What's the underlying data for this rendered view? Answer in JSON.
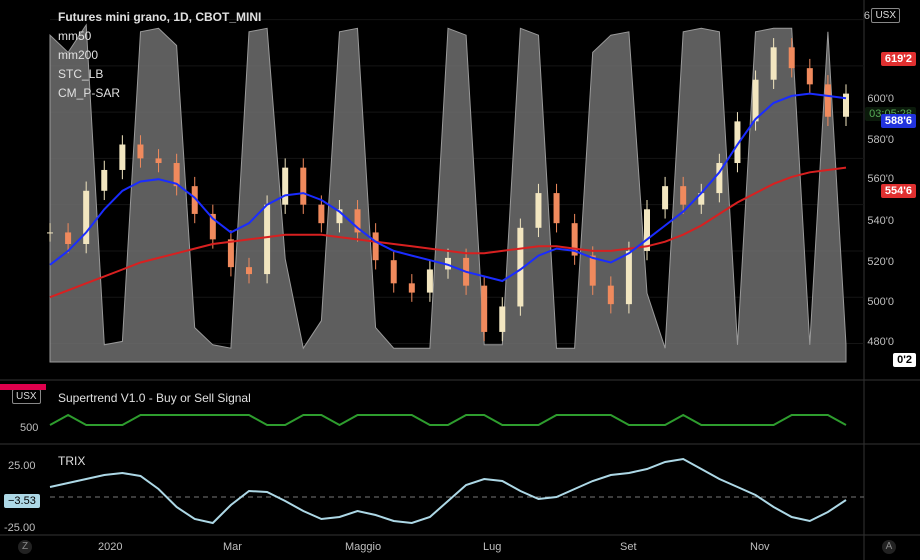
{
  "legend": {
    "title": "Futures mini grano, 1D, CBOT_MINI",
    "items": [
      "mm50",
      "mm200",
      "STC_LB",
      "CM_P-SAR"
    ]
  },
  "currency": "USX",
  "currency2": "USX",
  "price_axis": {
    "ticks": [
      "6",
      "600'0",
      "580'0",
      "560'0",
      "540'0",
      "520'0",
      "500'0",
      "480'0"
    ],
    "tags": {
      "psar": "619'2",
      "last": "588'6",
      "countdown": "03:05:28",
      "mm50": "554'6",
      "stc": "0'2"
    },
    "colors": {
      "psar": "#e03030",
      "last": "#2233dd",
      "mm50": "#e03030",
      "stc": "#ffffff"
    }
  },
  "supertrend": {
    "title": "Supertrend V1.0 - Buy or Sell Signal",
    "tick": "500",
    "tag_color": "#e0004d"
  },
  "trix": {
    "title": "TRIX",
    "ticks": [
      "25.00",
      "-25.00"
    ],
    "tag": "−3.53"
  },
  "x_axis": {
    "labels": [
      "2020",
      "Mar",
      "Maggio",
      "Lug",
      "Set",
      "Nov"
    ]
  },
  "corner_left": "Z",
  "corner_right": "A",
  "chart_data": {
    "type": "line",
    "x_labels": [
      "2020",
      "Mar",
      "Maggio",
      "Lug",
      "Set",
      "Nov"
    ],
    "ylim": [
      472,
      625
    ],
    "series": [
      {
        "name": "mm50",
        "color": "#1a2cff",
        "values": [
          514,
          520,
          528,
          538,
          546,
          550,
          551,
          549,
          543,
          534,
          528,
          532,
          540,
          544,
          545,
          542,
          537,
          530,
          524,
          520,
          518,
          516,
          514,
          511,
          509,
          507,
          512,
          518,
          521,
          520,
          517,
          515,
          519,
          525,
          531,
          537,
          545,
          554,
          566,
          577,
          584,
          587,
          588,
          587,
          586
        ]
      },
      {
        "name": "mm200",
        "color": "#d82020",
        "values": [
          500,
          503,
          506,
          509,
          512,
          515,
          517,
          519,
          521,
          523,
          524,
          525,
          526,
          527,
          527,
          527,
          526,
          525,
          524,
          523,
          522,
          521,
          520,
          519,
          519,
          520,
          521,
          522,
          522,
          521,
          520,
          520,
          521,
          522,
          524,
          527,
          531,
          536,
          541,
          545,
          549,
          552,
          554,
          555,
          556
        ]
      },
      {
        "name": "close",
        "color": "#f0b070",
        "values": [
          528,
          523,
          546,
          555,
          566,
          560,
          558,
          548,
          536,
          525,
          513,
          510,
          540,
          556,
          540,
          532,
          538,
          528,
          516,
          506,
          502,
          512,
          517,
          505,
          485,
          496,
          530,
          545,
          532,
          518,
          505,
          497,
          520,
          538,
          548,
          540,
          545,
          558,
          576,
          594,
          608,
          599,
          592,
          578,
          588
        ]
      },
      {
        "name": "STC_LB",
        "color": "#b0b0b0",
        "values": [
          95,
          90,
          98,
          5,
          6,
          96,
          97,
          92,
          10,
          5,
          4,
          96,
          97,
          30,
          4,
          12,
          96,
          97,
          10,
          4,
          4,
          4,
          97,
          95,
          5,
          5,
          97,
          95,
          4,
          4,
          90,
          95,
          96,
          20,
          4,
          96,
          97,
          96,
          5,
          96,
          97,
          97,
          5,
          96,
          5
        ]
      },
      {
        "name": "TRIX",
        "color": "#add8e6",
        "values": [
          10,
          14,
          18,
          22,
          24,
          21,
          8,
          -10,
          -22,
          -26,
          -8,
          6,
          5,
          -4,
          -14,
          -22,
          -20,
          -14,
          -18,
          -24,
          -26,
          -20,
          -4,
          12,
          18,
          16,
          6,
          -2,
          0,
          8,
          16,
          22,
          24,
          28,
          35,
          38,
          28,
          18,
          10,
          2,
          -10,
          -20,
          -24,
          -15,
          -3
        ]
      }
    ]
  }
}
